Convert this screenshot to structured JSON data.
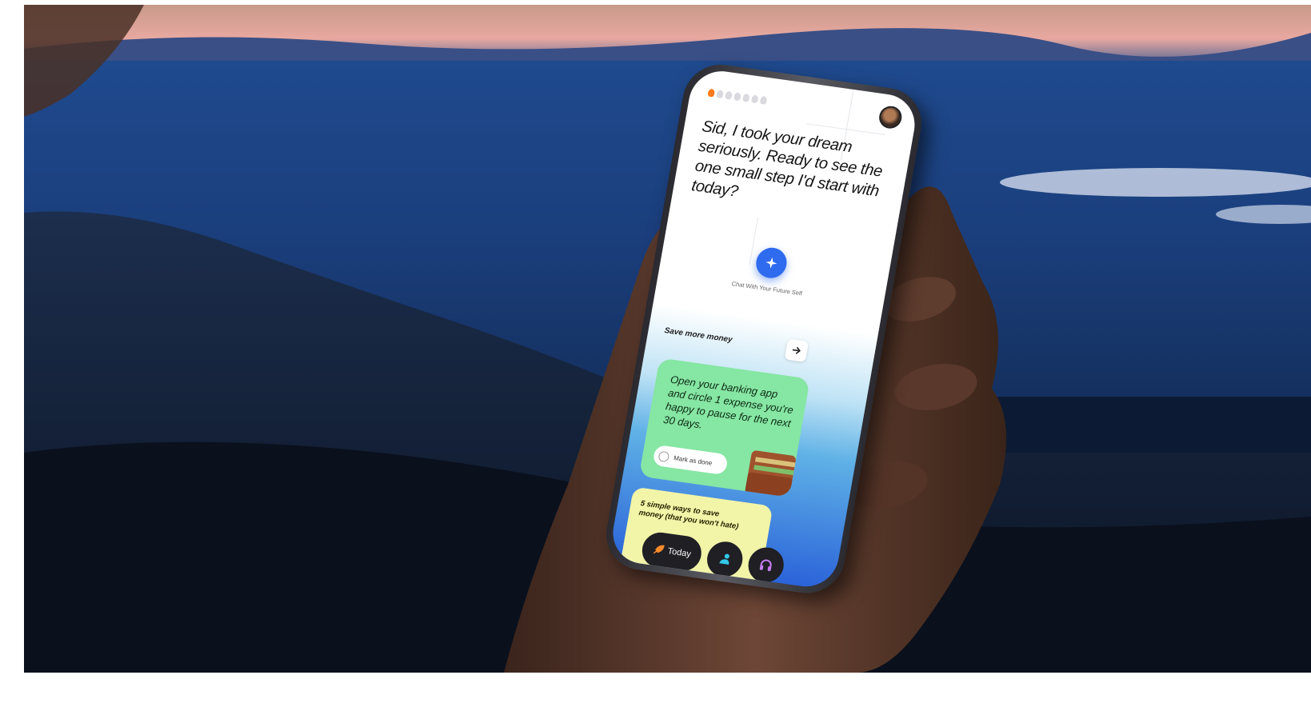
{
  "screen": {
    "streak_days_total": 7,
    "streak_days_active": 1,
    "headline": "Sid, I took your dream seriously. Ready to see the one small step I'd start with today?",
    "chat_button_icon": "sparkle-icon",
    "chat_label": "Chat With Your Future Self",
    "goal": {
      "title": "Save more money",
      "arrow_icon": "arrow-right-icon"
    },
    "task_card": {
      "text": "Open your banking app and circle 1 expense you're happy to pause for the next 30 days.",
      "mark_done_label": "Mark as done",
      "color": "#86e6a3"
    },
    "article_card": {
      "text": "5 simple ways to save money (that you won't hate)",
      "color": "#f2f4a8"
    },
    "tabbar": {
      "today_label": "Today",
      "today_icon": "rocket-icon",
      "second_icon": "person-icon",
      "third_icon": "headphones-icon"
    }
  }
}
